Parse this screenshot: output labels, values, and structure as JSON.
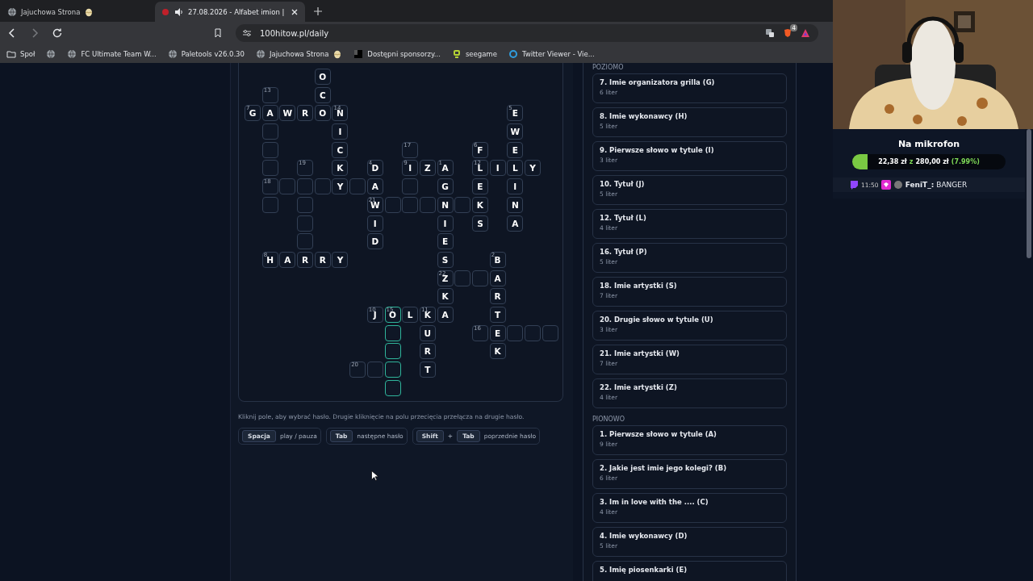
{
  "browser": {
    "tabs": [
      {
        "title": "Jajuchowa Strona",
        "selected": false,
        "audio": false
      },
      {
        "title": "27.08.2026 - Alfabet imion |",
        "selected": true,
        "audio": true
      }
    ],
    "address": "100hitow.pl/daily",
    "extension_badge": "4",
    "bookmarks": [
      {
        "kind": "folder",
        "label": "Społ"
      },
      {
        "kind": "globe"
      },
      {
        "kind": "globe",
        "label": "FC Ultimate Team W..."
      },
      {
        "kind": "globe",
        "label": "Paletools v26.0.30"
      },
      {
        "kind": "globe",
        "label": "Jajuchowa Strona",
        "egg": true
      },
      {
        "kind": "square",
        "label": "Dostępni sponsorzy..."
      },
      {
        "kind": "green",
        "label": "seegame"
      },
      {
        "kind": "ring",
        "label": "Twitter Viewer - Vie..."
      }
    ]
  },
  "crossword": {
    "rows": [
      {
        "cells": [
          "",
          "",
          "",
          "",
          {
            "letter": "O",
            "selected": false
          }
        ]
      },
      {
        "cells": [
          "",
          {
            "number": "13",
            "selected": false
          },
          "",
          "",
          {
            "letter": "C",
            "selected": false
          }
        ]
      },
      {
        "cells": [
          {
            "letter": "G",
            "number": "7",
            "selected": false
          },
          {
            "letter": "A",
            "selected": false
          },
          {
            "letter": "W",
            "selected": false
          },
          {
            "letter": "R",
            "selected": false
          },
          {
            "letter": "O",
            "selected": false
          },
          {
            "letter": "N",
            "number": "14",
            "selected": false
          },
          "",
          "",
          "",
          "",
          "",
          "",
          "",
          "",
          "",
          {
            "letter": "E",
            "number": "5",
            "selected": false
          }
        ]
      },
      {
        "cells": [
          "",
          {
            "selected": false
          },
          "",
          "",
          "",
          {
            "letter": "I",
            "selected": false
          },
          "",
          "",
          "",
          "",
          "",
          "",
          "",
          "",
          "",
          {
            "letter": "W",
            "selected": false
          }
        ]
      },
      {
        "cells": [
          "",
          {
            "selected": false
          },
          "",
          "",
          "",
          {
            "letter": "C",
            "selected": false
          },
          "",
          "",
          "",
          {
            "number": "17",
            "selected": false
          },
          "",
          "",
          "",
          {
            "letter": "F",
            "number": "6",
            "selected": false
          },
          "",
          {
            "letter": "E",
            "selected": false
          }
        ]
      },
      {
        "cells": [
          "",
          {
            "selected": false
          },
          "",
          {
            "number": "19",
            "selected": false
          },
          "",
          {
            "letter": "K",
            "selected": false
          },
          "",
          {
            "letter": "D",
            "number": "4",
            "selected": false
          },
          "",
          {
            "letter": "I",
            "number": "9",
            "selected": false
          },
          {
            "letter": "Z",
            "selected": false
          },
          {
            "letter": "A",
            "number": "1",
            "selected": false
          },
          "",
          {
            "letter": "L",
            "number": "12",
            "selected": false
          },
          {
            "letter": "I",
            "selected": false
          },
          {
            "letter": "L",
            "selected": false
          },
          {
            "letter": "Y",
            "selected": false
          }
        ]
      },
      {
        "cells": [
          "",
          {
            "number": "18",
            "selected": false
          },
          {
            "selected": false
          },
          {
            "selected": false
          },
          {
            "selected": false
          },
          {
            "letter": "Y",
            "selected": false
          },
          {
            "selected": false
          },
          {
            "letter": "A",
            "selected": false
          },
          "",
          {
            "selected": false
          },
          "",
          {
            "letter": "G",
            "selected": false
          },
          "",
          {
            "letter": "E",
            "selected": false
          },
          "",
          {
            "letter": "I",
            "selected": false
          }
        ]
      },
      {
        "cells": [
          "",
          {
            "selected": false
          },
          "",
          {
            "selected": false
          },
          "",
          "",
          "",
          {
            "letter": "W",
            "number": "21",
            "selected": false
          },
          {
            "selected": false
          },
          {
            "selected": false
          },
          {
            "selected": false
          },
          {
            "letter": "N",
            "selected": false
          },
          {
            "selected": false
          },
          {
            "letter": "K",
            "selected": false
          },
          "",
          {
            "letter": "N",
            "selected": false
          }
        ]
      },
      {
        "cells": [
          "",
          "",
          "",
          {
            "selected": false
          },
          "",
          "",
          "",
          {
            "letter": "I",
            "selected": false
          },
          "",
          "",
          "",
          {
            "letter": "I",
            "selected": false
          },
          "",
          {
            "letter": "S",
            "selected": false
          },
          "",
          {
            "letter": "A",
            "selected": false
          }
        ]
      },
      {
        "cells": [
          "",
          "",
          "",
          {
            "selected": false
          },
          "",
          "",
          "",
          {
            "letter": "D",
            "selected": false
          },
          "",
          "",
          "",
          {
            "letter": "E",
            "selected": false
          }
        ]
      },
      {
        "cells": [
          "",
          {
            "letter": "H",
            "number": "8",
            "selected": false
          },
          {
            "letter": "A",
            "selected": false
          },
          {
            "letter": "R",
            "selected": false
          },
          {
            "letter": "R",
            "selected": false
          },
          {
            "letter": "Y",
            "selected": false
          },
          "",
          "",
          "",
          "",
          "",
          {
            "letter": "S",
            "selected": false
          },
          "",
          "",
          {
            "letter": "B",
            "number": "2",
            "selected": false
          }
        ]
      },
      {
        "cells": [
          "",
          "",
          "",
          "",
          "",
          "",
          "",
          "",
          "",
          "",
          "",
          {
            "letter": "Z",
            "number": "22",
            "selected": false
          },
          {
            "selected": false
          },
          {
            "selected": false
          },
          {
            "letter": "A",
            "selected": false
          }
        ]
      },
      {
        "cells": [
          "",
          "",
          "",
          "",
          "",
          "",
          "",
          "",
          "",
          "",
          "",
          {
            "letter": "K",
            "selected": false
          },
          "",
          "",
          {
            "letter": "R",
            "selected": false
          }
        ]
      },
      {
        "cells": [
          "",
          "",
          "",
          "",
          "",
          "",
          "",
          {
            "letter": "J",
            "number": "10",
            "selected": false
          },
          {
            "letter": "O",
            "number": "15",
            "selected": true
          },
          {
            "letter": "L",
            "selected": false
          },
          {
            "letter": "K",
            "number": "11",
            "selected": false
          },
          {
            "letter": "A",
            "selected": false
          },
          "",
          "",
          {
            "letter": "T",
            "selected": false
          }
        ]
      },
      {
        "cells": [
          "",
          "",
          "",
          "",
          "",
          "",
          "",
          "",
          {
            "selected": true
          },
          "",
          {
            "letter": "U",
            "selected": false
          },
          "",
          "",
          {
            "number": "16",
            "selected": false
          },
          {
            "letter": "E",
            "selected": false
          },
          {
            "selected": false
          },
          {
            "selected": false
          },
          {
            "selected": false
          }
        ]
      },
      {
        "cells": [
          "",
          "",
          "",
          "",
          "",
          "",
          "",
          "",
          {
            "selected": true
          },
          "",
          {
            "letter": "R",
            "selected": false
          },
          "",
          "",
          "",
          {
            "letter": "K",
            "selected": false
          }
        ]
      },
      {
        "cells": [
          "",
          "",
          "",
          "",
          "",
          "",
          {
            "number": "20",
            "selected": false
          },
          {
            "selected": false
          },
          {
            "selected": true
          },
          "",
          {
            "letter": "T",
            "selected": false
          }
        ]
      },
      {
        "cells": [
          "",
          "",
          "",
          "",
          "",
          "",
          "",
          "",
          {
            "selected": true
          }
        ]
      }
    ]
  },
  "help_text": "Kliknij pole, aby wybrać hasło. Drugie kliknięcie na polu przecięcia przełącza na drugie hasło.",
  "shortcuts": [
    {
      "keys": [
        "Spacja"
      ],
      "action": "play / pauza"
    },
    {
      "keys": [
        "Tab"
      ],
      "action": "następne hasło"
    },
    {
      "keys": [
        "Shift",
        "Tab"
      ],
      "joiner": "+",
      "action": "poprzednie hasło"
    }
  ],
  "clues": [
    {
      "heading": "POZIOMO",
      "items": [
        {
          "title": "7. Imie organizatora grilla (G)",
          "letters": "6 liter"
        },
        {
          "title": "8. Imie wykonawcy (H)",
          "letters": "5 liter"
        },
        {
          "title": "9. Pierwsze słowo w tytule (I)",
          "letters": "3 liter"
        },
        {
          "title": "10. Tytuł (J)",
          "letters": "5 liter"
        },
        {
          "title": "12. Tytuł (L)",
          "letters": "4 liter"
        },
        {
          "title": "16. Tytuł (P)",
          "letters": "5 liter"
        },
        {
          "title": "18. Imie artystki (S)",
          "letters": "7 liter"
        },
        {
          "title": "20. Drugie słowo w tytule (U)",
          "letters": "3 liter"
        },
        {
          "title": "21. Imie artystki (W)",
          "letters": "7 liter"
        },
        {
          "title": "22. Imie artystki (Z)",
          "letters": "4 liter"
        }
      ]
    },
    {
      "heading": "PIONOWO",
      "items": [
        {
          "title": "1. Pierwsze słowo w tytule (A)",
          "letters": "9 liter"
        },
        {
          "title": "2. Jakie jest imie jego kolegi? (B)",
          "letters": "6 liter"
        },
        {
          "title": "3. Im in love with the .... (C)",
          "letters": "4 liter"
        },
        {
          "title": "4. Imie wykonawcy (D)",
          "letters": "5 liter"
        },
        {
          "title": "5. Imię piosenkarki (E)"
        }
      ]
    }
  ],
  "stream": {
    "goal": {
      "title": "Na mikrofon",
      "level": 0.0799,
      "current": "22,38 zł",
      "separator": "z",
      "target": "280,00 zł",
      "percent": "(7.99%)"
    },
    "chat": [
      {
        "time": "11:50",
        "user": "FeniT_:",
        "message": "BANGER"
      }
    ]
  }
}
